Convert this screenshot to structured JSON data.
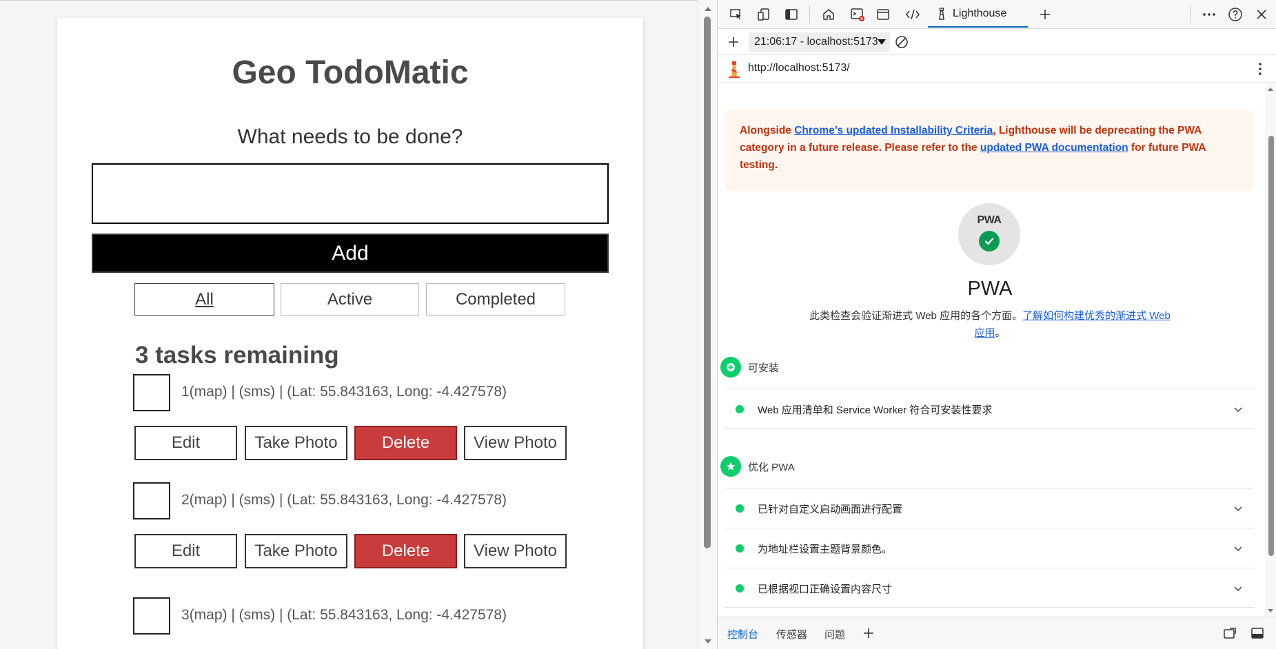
{
  "app": {
    "title": "Geo TodoMatic",
    "prompt": "What needs to be done?",
    "input_value": "",
    "add_label": "Add",
    "filters": {
      "all": "All",
      "active": "Active",
      "completed": "Completed"
    },
    "tasks_remaining": "3 tasks remaining",
    "task_buttons": {
      "edit": "Edit",
      "take_photo": "Take Photo",
      "delete": "Delete",
      "view_photo": "View Photo"
    },
    "tasks": [
      {
        "label": "1(map)  |  (sms)  |  (Lat: 55.843163, Long: -4.427578)"
      },
      {
        "label": "2(map)  |  (sms)  |  (Lat: 55.843163, Long: -4.427578)"
      },
      {
        "label": "3(map)  |  (sms)  |  (Lat: 55.843163, Long: -4.427578)"
      }
    ]
  },
  "devtools": {
    "active_tab": "Lighthouse",
    "report_select": "21:06:17 - localhost:5173",
    "report_url": "http://localhost:5173/",
    "warning": {
      "t1": "Alongside ",
      "link1": "Chrome’s updated Installability Criteria",
      "t2": ", Lighthouse will be deprecating the PWA category in a future release. Please refer to the ",
      "link2": "updated PWA documentation",
      "t3": " for future PWA testing."
    },
    "pwa": {
      "badge_text": "PWA",
      "title": "PWA",
      "description": "此类检查会验证渐进式 Web 应用的各个方面。",
      "learn_more": "了解如何构建优秀的渐进式 Web 应用",
      "learn_more_suffix": "。"
    },
    "groups": {
      "installable": {
        "title": "可安装",
        "audits": [
          "Web 应用清单和 Service Worker 符合可安装性要求"
        ]
      },
      "optimized": {
        "title": "优化 PWA",
        "audits": [
          "已针对自定义启动画面进行配置",
          "为地址栏设置主题背景颜色。",
          "已根据视口正确设置内容尺寸"
        ]
      }
    },
    "drawer": {
      "console": "控制台",
      "sensors": "传感器",
      "issues": "问题"
    },
    "colors": {
      "accent": "#0a64c2",
      "pass": "#0cce6b",
      "warning_text": "#c0330e",
      "delete": "#ca3c3c"
    }
  }
}
